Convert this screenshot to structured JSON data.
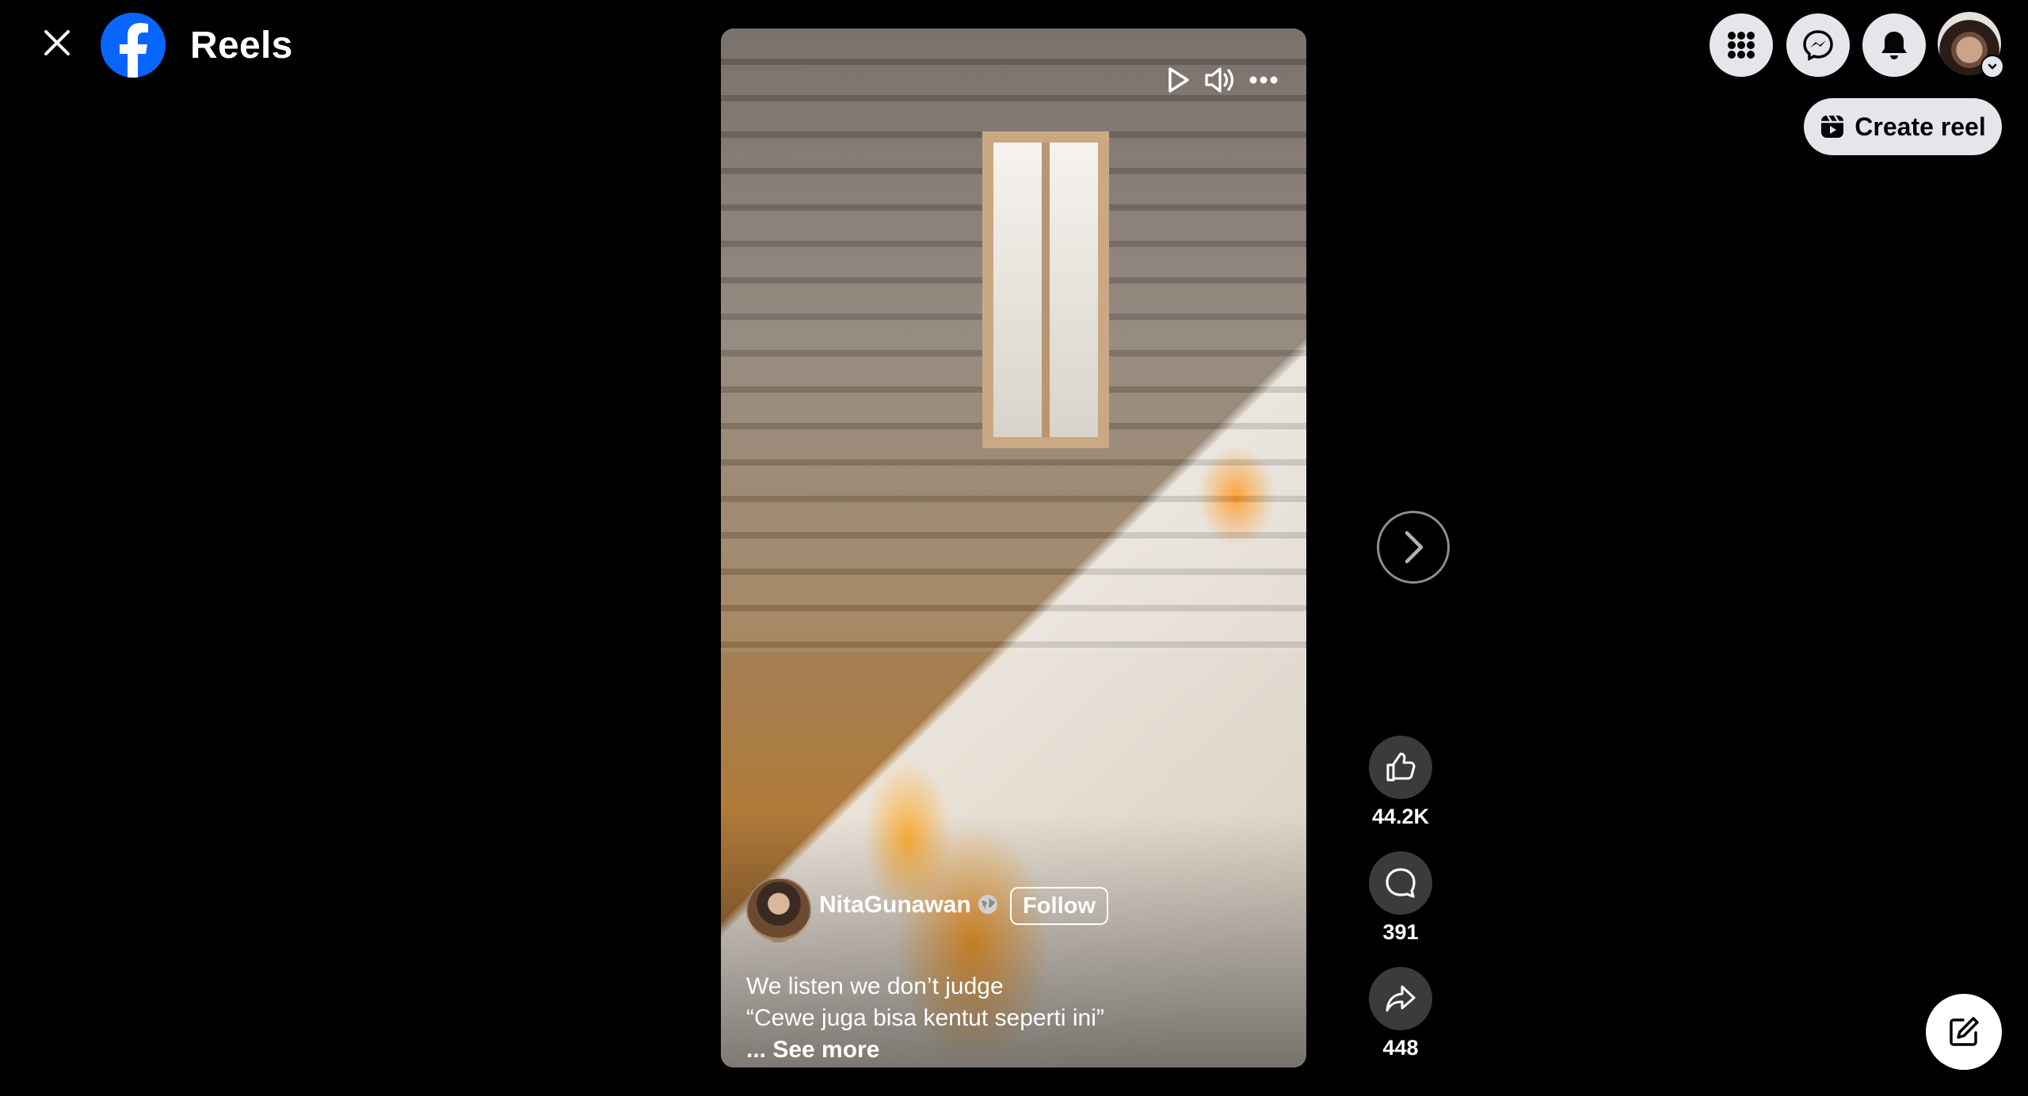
{
  "header": {
    "title": "Reels"
  },
  "topbar": {
    "create_reel_label": "Create reel"
  },
  "reel": {
    "author": "NitaGunawan",
    "follow_label": "Follow",
    "caption_line1": "We listen we don’t judge",
    "caption_line2": "“Cewe juga bisa kentut seperti ini”",
    "see_more_label": "... See more"
  },
  "actions": {
    "likes": "44.2K",
    "comments": "391",
    "shares": "448"
  },
  "colors": {
    "brand": "#0866ff",
    "background": "#000000",
    "button_bg": "#e4e6eb",
    "action_bg": "#3a3b3c"
  }
}
